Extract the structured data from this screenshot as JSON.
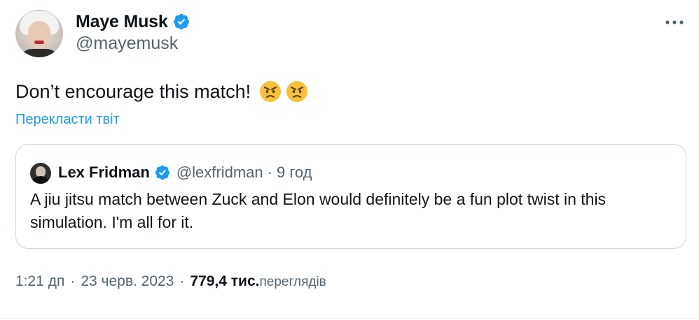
{
  "author": {
    "display_name": "Maye Musk",
    "handle": "@mayemusk"
  },
  "tweet": {
    "text": "Don’t encourage this match!",
    "emojis": [
      "angry-face",
      "angry-face"
    ],
    "translate_label": "Перекласти твіт"
  },
  "quoted_tweet": {
    "display_name": "Lex Fridman",
    "handle": "@lexfridman",
    "separator": "·",
    "time": "9 год",
    "text": "A jiu jitsu match between Zuck and Elon would definitely be a fun plot twist in this simulation. I'm all for it."
  },
  "meta": {
    "time": "1:21 дп",
    "separator": "·",
    "date": "23 черв. 2023",
    "views_count": "779,4 тис.",
    "views_label": "переглядів"
  },
  "colors": {
    "verified": "#1d9bf0",
    "link": "#1d9bf0",
    "secondary_text": "#536471",
    "border": "#cfd9de"
  }
}
